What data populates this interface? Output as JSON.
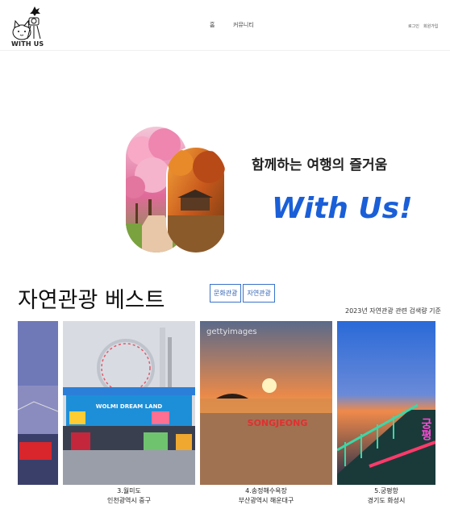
{
  "header": {
    "logo_text": "WITH US",
    "nav": [
      "홈",
      "커뮤니티"
    ],
    "auth": {
      "login": "로그인",
      "signup": "회원가입"
    }
  },
  "hero": {
    "title": "함께하는 여행의 즐거움",
    "brand": "With Us!"
  },
  "section": {
    "title": "자연관광 베스트",
    "tabs": [
      "문화관광",
      "자연관광"
    ],
    "note": "2023년 자연관광 관련 검색량 기준"
  },
  "cards": [
    {
      "title": "",
      "location": "",
      "overlay": ""
    },
    {
      "title": "3.월미도",
      "location": "인천광역시 중구",
      "overlay": "WOLMI DREAM LAND"
    },
    {
      "title": "4.송정해수욕장",
      "location": "부산광역시 해운대구",
      "overlay": "SONGJEONG"
    },
    {
      "title": "5.궁평항",
      "location": "경기도 화성시",
      "overlay": "궁평"
    }
  ],
  "watermark": "gettyimages",
  "colors": {
    "brand": "#1a5fd8",
    "tab_border": "#3a73c9"
  }
}
